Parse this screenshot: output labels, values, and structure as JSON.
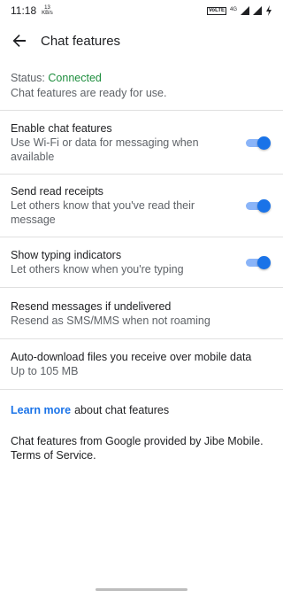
{
  "statusbar": {
    "time": "11:18",
    "speed_value": "13",
    "speed_unit": "KB/s",
    "volte": "VoLTE",
    "network": "4G"
  },
  "appbar": {
    "title": "Chat features"
  },
  "status": {
    "label": "Status: ",
    "value": "Connected",
    "description": "Chat features are ready for use.",
    "value_color": "#1e8e3e"
  },
  "settings": [
    {
      "label": "Enable chat features",
      "sub": "Use Wi-Fi or data for messaging when available",
      "enabled": true
    },
    {
      "label": "Send read receipts",
      "sub": "Let others know that you've read their message",
      "enabled": true
    },
    {
      "label": "Show typing indicators",
      "sub": "Let others know when you're typing",
      "enabled": true
    },
    {
      "label": "Resend messages if undelivered",
      "sub": "Resend as SMS/MMS when not roaming"
    },
    {
      "label": "Auto-download files you receive over mobile data",
      "sub": "Up to 105 MB"
    }
  ],
  "learn_more": {
    "link": "Learn more",
    "rest": "about chat features"
  },
  "footer": {
    "provider": "Chat features from Google provided by Jibe Mobile.",
    "terms": "Terms of Service."
  },
  "colors": {
    "accent": "#1a73e8",
    "toggle_track": "#8ab4f8",
    "divider": "#e0e0e0"
  }
}
